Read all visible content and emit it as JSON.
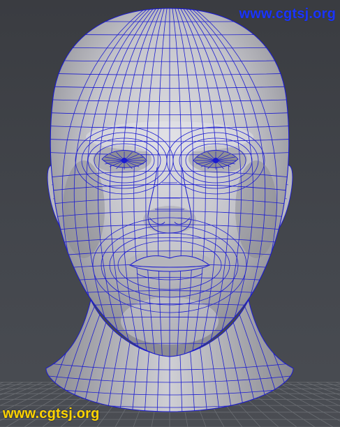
{
  "app": {
    "panel": "3d-viewport",
    "view": "front-orthographic",
    "shading": "smooth-shade-with-wireframe"
  },
  "viewport": {
    "background_color": "#404349",
    "grid_color": "#6a6d72",
    "mesh_surface_color": "#c9c9ce",
    "wireframe_color": "#1b1bd0"
  },
  "watermarks": {
    "top": "www.cgtsj.org",
    "bottom": "www.cgtsj.org"
  }
}
